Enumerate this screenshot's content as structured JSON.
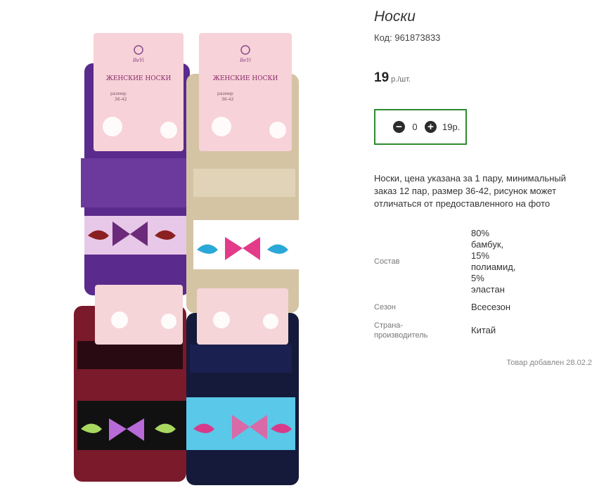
{
  "product": {
    "title": "Носки",
    "code_label": "Код:",
    "code": "961873833",
    "price_value": "19",
    "price_unit": "р./шт.",
    "quantity": "0",
    "quantity_sum": "19р.",
    "description": "Носки, цена указана за 1 пару, минимальный заказ 12 пар, размер 36-42, рисунок может отличаться от предоставленного на фото",
    "added_text": "Товар добавлен 28.02.2"
  },
  "properties": [
    {
      "label": "Состав",
      "value": "80% бамбук, 15% полиамид, 5% эластан"
    },
    {
      "label": "Сезон",
      "value": "Всесезон"
    },
    {
      "label": "Страна-производитель",
      "value": "Китай"
    }
  ],
  "image": {
    "brand_text": "BeYi",
    "tag_text": "ЖЕНСКИЕ НОСКИ",
    "size_label": "размер",
    "size_value": "36-42"
  },
  "colors": {
    "accent_border": "#2e8b2e",
    "button_bg": "#2b2b2b"
  },
  "icons": {
    "minus": "minus-circle-icon",
    "plus": "plus-circle-icon"
  }
}
